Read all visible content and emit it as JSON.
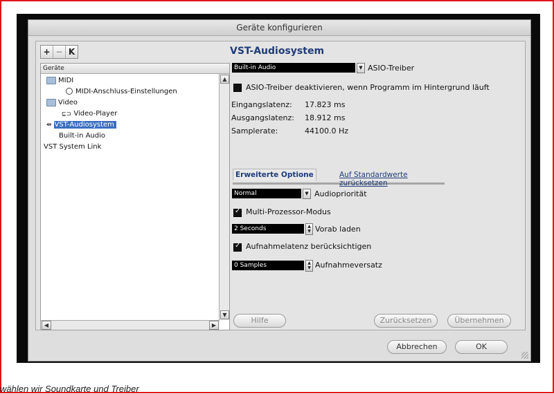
{
  "window": {
    "title": "Geräte konfigurieren"
  },
  "toolbar": {
    "add": "+",
    "remove": "−",
    "reset": "K"
  },
  "tree": {
    "header": "Geräte",
    "items": [
      {
        "label": "MIDI"
      },
      {
        "label": "MIDI-Anschluss-Einstellungen"
      },
      {
        "label": "Video"
      },
      {
        "label": "Video-Player"
      },
      {
        "label": "VST-Audiosystem"
      },
      {
        "label": "Built-in Audio"
      },
      {
        "label": "VST System Link"
      }
    ],
    "scroll_up": "▲",
    "scroll_down": "▼",
    "scroll_left": "◀",
    "scroll_right": "▶"
  },
  "panel": {
    "title": "VST-Audiosystem",
    "driver_value": "Built-in Audio",
    "driver_label": "ASIO-Treiber",
    "deactivate_label": "ASIO-Treiber deaktivieren, wenn Programm im Hintergrund läuft",
    "input_latency_label": "Eingangslatenz:",
    "input_latency_value": "17.823 ms",
    "output_latency_label": "Ausgangslatenz:",
    "output_latency_value": "18.912 ms",
    "samplerate_label": "Samplerate:",
    "samplerate_value": "44100.0 Hz"
  },
  "advanced": {
    "tab_label": "Erweiterte Optione",
    "defaults_link": "Auf Standardwerte zurücksetzen",
    "priority_value": "Normal",
    "priority_label": "Audiopriorität",
    "multiprocessor_label": "Multi-Prozessor-Modus",
    "preload_value": "2 Seconds",
    "preload_label": "Vorab laden",
    "rec_latency_label": "Aufnahmelatenz berücksichtigen",
    "rec_offset_value": "0 Samples",
    "rec_offset_label": "Aufnahmeversatz"
  },
  "buttons": {
    "help": "Hilfe",
    "revert": "Zurücksetzen",
    "apply": "Übernehmen",
    "cancel": "Abbrechen",
    "ok": "OK"
  },
  "caption": "wählen wir Soundkarte und Treiber"
}
